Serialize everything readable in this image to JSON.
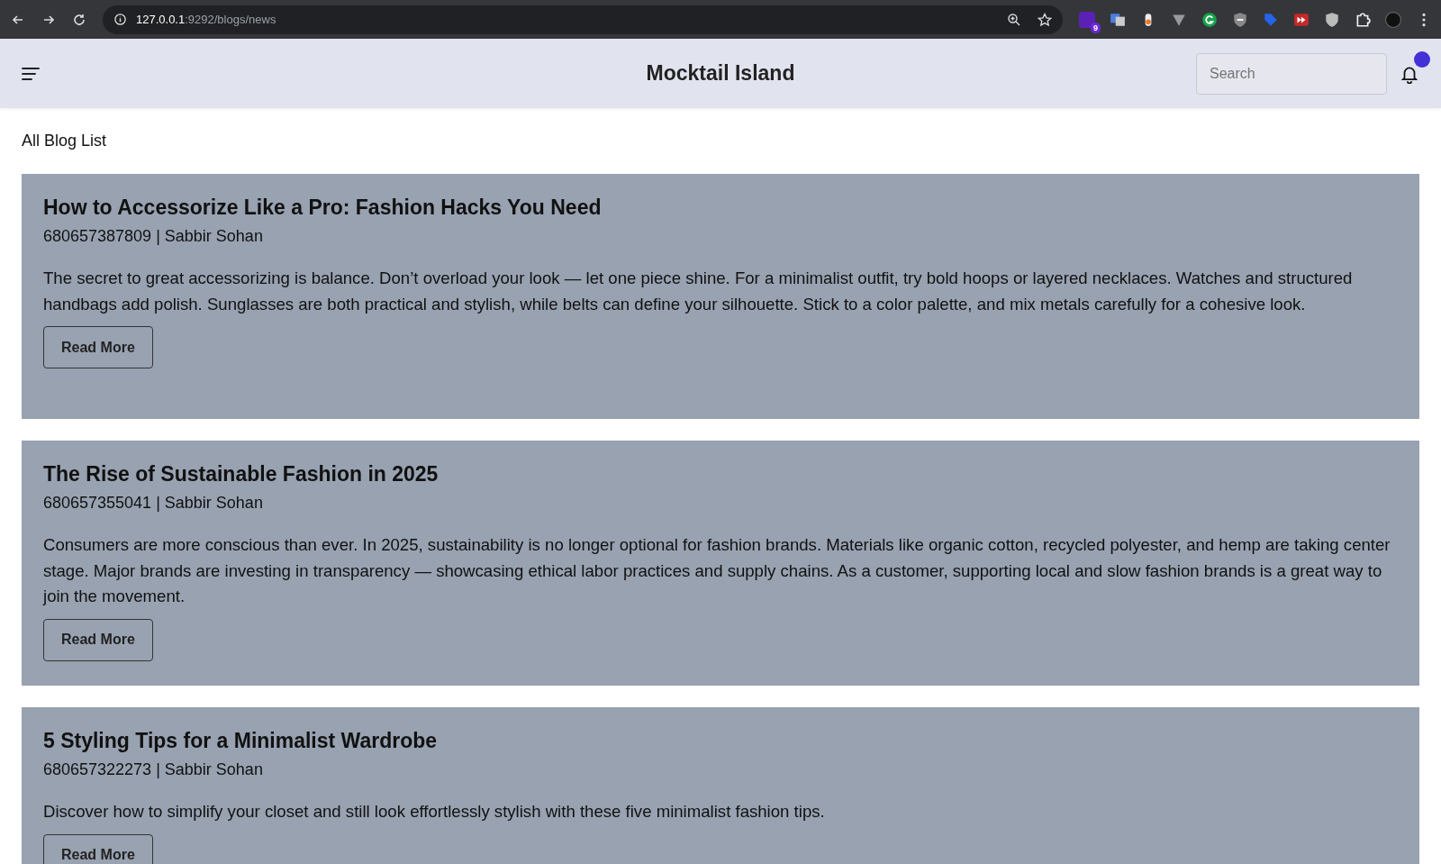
{
  "browser": {
    "url_host": "127.0.0.1",
    "url_path": ":9292/blogs/news",
    "extension_badge": "9"
  },
  "header": {
    "title": "Mocktail Island",
    "search": {
      "placeholder": "Search"
    },
    "notification_dot": true
  },
  "page_heading": "All Blog List",
  "posts": [
    {
      "title": "How to Accessorize Like a Pro: Fashion Hacks You Need",
      "meta": "680657387809 | Sabbir Sohan",
      "body": "The secret to great accessorizing is balance. Don’t overload your look — let one piece shine. For a minimalist outfit, try bold hoops or layered necklaces. Watches and structured handbags add polish. Sunglasses are both practical and stylish, while belts can define your silhouette. Stick to a color palette, and mix metals carefully for a cohesive look.",
      "button": "Read More"
    },
    {
      "title": "The Rise of Sustainable Fashion in 2025",
      "meta": "680657355041 | Sabbir Sohan",
      "body": "Consumers are more conscious than ever. In 2025, sustainability is no longer optional for fashion brands. Materials like organic cotton, recycled polyester, and hemp are taking center stage. Major brands are investing in transparency — showcasing ethical labor practices and supply chains. As a customer, supporting local and slow fashion brands is a great way to join the movement.",
      "button": "Read More"
    },
    {
      "title": "5 Styling Tips for a Minimalist Wardrobe",
      "meta": "680657322273 | Sabbir Sohan",
      "body": "Discover how to simplify your closet and still look effortlessly stylish with these five minimalist fashion tips.",
      "button": "Read More"
    }
  ]
}
